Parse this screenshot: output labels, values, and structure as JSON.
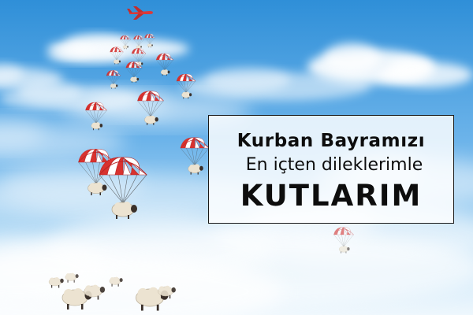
{
  "greeting": {
    "line1": "Kurban Bayramızı",
    "line2": "En içten dileklerimle",
    "line3": "KUTLARIM"
  },
  "colors": {
    "sky_top": "#2f8fd8",
    "sky_mid": "#8cc6f0",
    "sky_bottom": "#e8f4fc",
    "airplane": "#d93a3a",
    "parachute_red": "#d8322f",
    "parachute_white": "#ffffff",
    "sheep_wool": "#ece3d1",
    "sheep_head": "#3a302a",
    "box_border": "#1a1a1a",
    "text": "#0d0d0d"
  },
  "icons": {
    "airplane": "airplane-icon",
    "parachute_sheep": "parachute-sheep-icon",
    "sheep": "sheep-icon",
    "cloud": "cloud-shape"
  }
}
